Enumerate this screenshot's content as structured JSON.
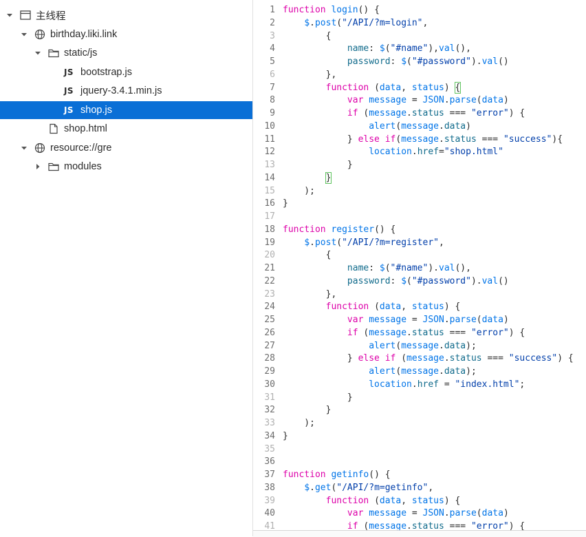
{
  "tree": {
    "items": [
      {
        "label": "主线程",
        "depth": 0,
        "expanded": true,
        "icon": "window-icon"
      },
      {
        "label": "birthday.liki.link",
        "depth": 1,
        "expanded": true,
        "icon": "globe-icon"
      },
      {
        "label": "static/js",
        "depth": 2,
        "expanded": true,
        "icon": "folder-icon"
      },
      {
        "label": "bootstrap.js",
        "depth": 3,
        "icon": "js-file-icon",
        "badge": "JS"
      },
      {
        "label": "jquery-3.4.1.min.js",
        "depth": 3,
        "icon": "js-file-icon",
        "badge": "JS"
      },
      {
        "label": "shop.js",
        "depth": 3,
        "icon": "js-file-icon",
        "badge": "JS",
        "selected": true
      },
      {
        "label": "shop.html",
        "depth": 2,
        "icon": "file-icon"
      },
      {
        "label": "resource://gre",
        "depth": 1,
        "expanded": true,
        "icon": "globe-icon"
      },
      {
        "label": "modules",
        "depth": 2,
        "expanded": false,
        "icon": "folder-icon"
      }
    ]
  },
  "editor": {
    "lines": [
      {
        "n": "1",
        "tokens": [
          [
            "kw",
            "function "
          ],
          [
            "fn",
            "login"
          ],
          [
            "pr",
            "() {"
          ]
        ]
      },
      {
        "n": "2",
        "tokens": [
          [
            "pr",
            "    "
          ],
          [
            "fn",
            "$"
          ],
          [
            "pr",
            "."
          ],
          [
            "fn",
            "post"
          ],
          [
            "pr",
            "("
          ],
          [
            "str",
            "\"/API/?m=login\""
          ],
          [
            "pr",
            ","
          ]
        ]
      },
      {
        "n": "3",
        "tokens": [
          [
            "pr",
            "        {"
          ]
        ]
      },
      {
        "n": "4",
        "tokens": [
          [
            "pr",
            "            "
          ],
          [
            "prop",
            "name"
          ],
          [
            "pr",
            ": "
          ],
          [
            "fn",
            "$"
          ],
          [
            "pr",
            "("
          ],
          [
            "str",
            "\"#name\""
          ],
          [
            "pr",
            "),"
          ],
          [
            "fn",
            "val"
          ],
          [
            "pr",
            "(),"
          ]
        ]
      },
      {
        "n": "5",
        "tokens": [
          [
            "pr",
            "            "
          ],
          [
            "prop",
            "password"
          ],
          [
            "pr",
            ": "
          ],
          [
            "fn",
            "$"
          ],
          [
            "pr",
            "("
          ],
          [
            "str",
            "\"#password\""
          ],
          [
            "pr",
            ")."
          ],
          [
            "fn",
            "val"
          ],
          [
            "pr",
            "()"
          ]
        ]
      },
      {
        "n": "6",
        "tokens": [
          [
            "pr",
            "        },"
          ]
        ]
      },
      {
        "n": "7",
        "tokens": [
          [
            "pr",
            "        "
          ],
          [
            "kw",
            "function "
          ],
          [
            "pr",
            "("
          ],
          [
            "fn",
            "data"
          ],
          [
            "pr",
            ", "
          ],
          [
            "fn",
            "status"
          ],
          [
            "pr",
            ") "
          ],
          [
            "hl",
            "{"
          ]
        ]
      },
      {
        "n": "8",
        "tokens": [
          [
            "pr",
            "            "
          ],
          [
            "kw",
            "var "
          ],
          [
            "fn",
            "message"
          ],
          [
            "pr",
            " = "
          ],
          [
            "fn",
            "JSON"
          ],
          [
            "pr",
            "."
          ],
          [
            "fn",
            "parse"
          ],
          [
            "pr",
            "("
          ],
          [
            "fn",
            "data"
          ],
          [
            "pr",
            ")"
          ]
        ]
      },
      {
        "n": "9",
        "tokens": [
          [
            "pr",
            "            "
          ],
          [
            "kw",
            "if "
          ],
          [
            "pr",
            "("
          ],
          [
            "fn",
            "message"
          ],
          [
            "pr",
            "."
          ],
          [
            "prop",
            "status"
          ],
          [
            "pr",
            " === "
          ],
          [
            "str",
            "\"error\""
          ],
          [
            "pr",
            ") {"
          ]
        ]
      },
      {
        "n": "10",
        "tokens": [
          [
            "pr",
            "                "
          ],
          [
            "fn",
            "alert"
          ],
          [
            "pr",
            "("
          ],
          [
            "fn",
            "message"
          ],
          [
            "pr",
            "."
          ],
          [
            "prop",
            "data"
          ],
          [
            "pr",
            ")"
          ]
        ]
      },
      {
        "n": "11",
        "tokens": [
          [
            "pr",
            "            } "
          ],
          [
            "kw",
            "else if"
          ],
          [
            "pr",
            "("
          ],
          [
            "fn",
            "message"
          ],
          [
            "pr",
            "."
          ],
          [
            "prop",
            "status"
          ],
          [
            "pr",
            " === "
          ],
          [
            "str",
            "\"success\""
          ],
          [
            "pr",
            "){"
          ]
        ]
      },
      {
        "n": "12",
        "tokens": [
          [
            "pr",
            "                "
          ],
          [
            "fn",
            "location"
          ],
          [
            "pr",
            "."
          ],
          [
            "prop",
            "href"
          ],
          [
            "pr",
            "="
          ],
          [
            "str",
            "\"shop.html\""
          ]
        ]
      },
      {
        "n": "13",
        "tokens": [
          [
            "pr",
            "            }"
          ]
        ]
      },
      {
        "n": "14",
        "tokens": [
          [
            "pr",
            "        "
          ],
          [
            "hl",
            "}"
          ]
        ]
      },
      {
        "n": "15",
        "tokens": [
          [
            "pr",
            "    );"
          ]
        ]
      },
      {
        "n": "16",
        "tokens": [
          [
            "pr",
            "}"
          ]
        ]
      },
      {
        "n": "17",
        "tokens": []
      },
      {
        "n": "18",
        "tokens": [
          [
            "kw",
            "function "
          ],
          [
            "fn",
            "register"
          ],
          [
            "pr",
            "() {"
          ]
        ]
      },
      {
        "n": "19",
        "tokens": [
          [
            "pr",
            "    "
          ],
          [
            "fn",
            "$"
          ],
          [
            "pr",
            "."
          ],
          [
            "fn",
            "post"
          ],
          [
            "pr",
            "("
          ],
          [
            "str",
            "\"/API/?m=register\""
          ],
          [
            "pr",
            ","
          ]
        ]
      },
      {
        "n": "20",
        "tokens": [
          [
            "pr",
            "        {"
          ]
        ]
      },
      {
        "n": "21",
        "tokens": [
          [
            "pr",
            "            "
          ],
          [
            "prop",
            "name"
          ],
          [
            "pr",
            ": "
          ],
          [
            "fn",
            "$"
          ],
          [
            "pr",
            "("
          ],
          [
            "str",
            "\"#name\""
          ],
          [
            "pr",
            ")."
          ],
          [
            "fn",
            "val"
          ],
          [
            "pr",
            "(),"
          ]
        ]
      },
      {
        "n": "22",
        "tokens": [
          [
            "pr",
            "            "
          ],
          [
            "prop",
            "password"
          ],
          [
            "pr",
            ": "
          ],
          [
            "fn",
            "$"
          ],
          [
            "pr",
            "("
          ],
          [
            "str",
            "\"#password\""
          ],
          [
            "pr",
            ")."
          ],
          [
            "fn",
            "val"
          ],
          [
            "pr",
            "()"
          ]
        ]
      },
      {
        "n": "23",
        "tokens": [
          [
            "pr",
            "        },"
          ]
        ]
      },
      {
        "n": "24",
        "tokens": [
          [
            "pr",
            "        "
          ],
          [
            "kw",
            "function "
          ],
          [
            "pr",
            "("
          ],
          [
            "fn",
            "data"
          ],
          [
            "pr",
            ", "
          ],
          [
            "fn",
            "status"
          ],
          [
            "pr",
            ") {"
          ]
        ]
      },
      {
        "n": "25",
        "tokens": [
          [
            "pr",
            "            "
          ],
          [
            "kw",
            "var "
          ],
          [
            "fn",
            "message"
          ],
          [
            "pr",
            " = "
          ],
          [
            "fn",
            "JSON"
          ],
          [
            "pr",
            "."
          ],
          [
            "fn",
            "parse"
          ],
          [
            "pr",
            "("
          ],
          [
            "fn",
            "data"
          ],
          [
            "pr",
            ")"
          ]
        ]
      },
      {
        "n": "26",
        "tokens": [
          [
            "pr",
            "            "
          ],
          [
            "kw",
            "if "
          ],
          [
            "pr",
            "("
          ],
          [
            "fn",
            "message"
          ],
          [
            "pr",
            "."
          ],
          [
            "prop",
            "status"
          ],
          [
            "pr",
            " === "
          ],
          [
            "str",
            "\"error\""
          ],
          [
            "pr",
            ") {"
          ]
        ]
      },
      {
        "n": "27",
        "tokens": [
          [
            "pr",
            "                "
          ],
          [
            "fn",
            "alert"
          ],
          [
            "pr",
            "("
          ],
          [
            "fn",
            "message"
          ],
          [
            "pr",
            "."
          ],
          [
            "prop",
            "data"
          ],
          [
            "pr",
            ");"
          ]
        ]
      },
      {
        "n": "28",
        "tokens": [
          [
            "pr",
            "            } "
          ],
          [
            "kw",
            "else if "
          ],
          [
            "pr",
            "("
          ],
          [
            "fn",
            "message"
          ],
          [
            "pr",
            "."
          ],
          [
            "prop",
            "status"
          ],
          [
            "pr",
            " === "
          ],
          [
            "str",
            "\"success\""
          ],
          [
            "pr",
            ") {"
          ]
        ]
      },
      {
        "n": "29",
        "tokens": [
          [
            "pr",
            "                "
          ],
          [
            "fn",
            "alert"
          ],
          [
            "pr",
            "("
          ],
          [
            "fn",
            "message"
          ],
          [
            "pr",
            "."
          ],
          [
            "prop",
            "data"
          ],
          [
            "pr",
            ");"
          ]
        ]
      },
      {
        "n": "30",
        "tokens": [
          [
            "pr",
            "                "
          ],
          [
            "fn",
            "location"
          ],
          [
            "pr",
            "."
          ],
          [
            "prop",
            "href"
          ],
          [
            "pr",
            " = "
          ],
          [
            "str",
            "\"index.html\""
          ],
          [
            "pr",
            ";"
          ]
        ]
      },
      {
        "n": "31",
        "tokens": [
          [
            "pr",
            "            }"
          ]
        ]
      },
      {
        "n": "32",
        "tokens": [
          [
            "pr",
            "        }"
          ]
        ]
      },
      {
        "n": "33",
        "tokens": [
          [
            "pr",
            "    );"
          ]
        ]
      },
      {
        "n": "34",
        "tokens": [
          [
            "pr",
            "}"
          ]
        ]
      },
      {
        "n": "35",
        "tokens": []
      },
      {
        "n": "36",
        "tokens": []
      },
      {
        "n": "37",
        "tokens": [
          [
            "kw",
            "function "
          ],
          [
            "fn",
            "getinfo"
          ],
          [
            "pr",
            "() {"
          ]
        ]
      },
      {
        "n": "38",
        "tokens": [
          [
            "pr",
            "    "
          ],
          [
            "fn",
            "$"
          ],
          [
            "pr",
            "."
          ],
          [
            "fn",
            "get"
          ],
          [
            "pr",
            "("
          ],
          [
            "str",
            "\"/API/?m=getinfo\""
          ],
          [
            "pr",
            ","
          ]
        ]
      },
      {
        "n": "39",
        "tokens": [
          [
            "pr",
            "        "
          ],
          [
            "kw",
            "function "
          ],
          [
            "pr",
            "("
          ],
          [
            "fn",
            "data"
          ],
          [
            "pr",
            ", "
          ],
          [
            "fn",
            "status"
          ],
          [
            "pr",
            ") {"
          ]
        ]
      },
      {
        "n": "40",
        "tokens": [
          [
            "pr",
            "            "
          ],
          [
            "kw",
            "var "
          ],
          [
            "fn",
            "message"
          ],
          [
            "pr",
            " = "
          ],
          [
            "fn",
            "JSON"
          ],
          [
            "pr",
            "."
          ],
          [
            "fn",
            "parse"
          ],
          [
            "pr",
            "("
          ],
          [
            "fn",
            "data"
          ],
          [
            "pr",
            ")"
          ]
        ]
      },
      {
        "n": "41",
        "tokens": [
          [
            "pr",
            "            "
          ],
          [
            "kw",
            "if "
          ],
          [
            "pr",
            "("
          ],
          [
            "fn",
            "message"
          ],
          [
            "pr",
            "."
          ],
          [
            "prop",
            "status"
          ],
          [
            "pr",
            " === "
          ],
          [
            "str",
            "\"error\""
          ],
          [
            "pr",
            ") {"
          ]
        ]
      }
    ]
  }
}
